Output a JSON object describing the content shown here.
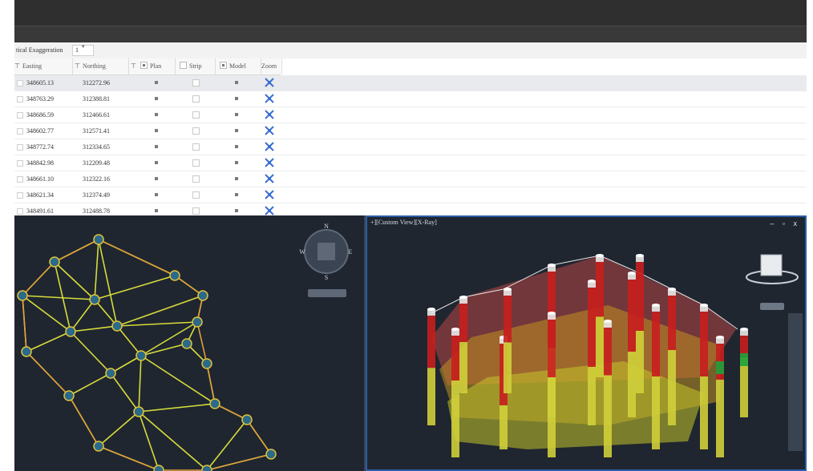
{
  "toolbar": {
    "exaggeration_label": "tical Exaggeration",
    "exaggeration_value": "1"
  },
  "columns": {
    "easting": "Easting",
    "northing": "Northing",
    "plan": "Plan",
    "strip": "Strip",
    "model": "Model",
    "zoom": "Zoom"
  },
  "rows": [
    {
      "easting": "348605.13",
      "northing": "312272.96",
      "plan": true,
      "strip": false,
      "model": true
    },
    {
      "easting": "348763.29",
      "northing": "312388.81",
      "plan": true,
      "strip": false,
      "model": true
    },
    {
      "easting": "348686.59",
      "northing": "312466.61",
      "plan": true,
      "strip": false,
      "model": true
    },
    {
      "easting": "348602.77",
      "northing": "312571.41",
      "plan": true,
      "strip": false,
      "model": true
    },
    {
      "easting": "348772.74",
      "northing": "312334.65",
      "plan": true,
      "strip": false,
      "model": true
    },
    {
      "easting": "348842.98",
      "northing": "312209.48",
      "plan": true,
      "strip": false,
      "model": true
    },
    {
      "easting": "348661.10",
      "northing": "312322.16",
      "plan": true,
      "strip": false,
      "model": true
    },
    {
      "easting": "348621.34",
      "northing": "312374.49",
      "plan": true,
      "strip": false,
      "model": true
    },
    {
      "easting": "348491.61",
      "northing": "312488.78",
      "plan": true,
      "strip": false,
      "model": true
    }
  ],
  "compass": {
    "north": "N",
    "south": "S",
    "west": "W",
    "east": "E"
  },
  "viewport_right": {
    "title": "+][Custom View][X-Ray]",
    "controls": "– ▫ x"
  },
  "colors": {
    "viewport_bg": "#1f2630",
    "accent_blue": "#2b5ea8",
    "hole_red": "#c81e1e",
    "hole_yellow": "#d6d63a",
    "hole_green": "#1fa23a"
  }
}
